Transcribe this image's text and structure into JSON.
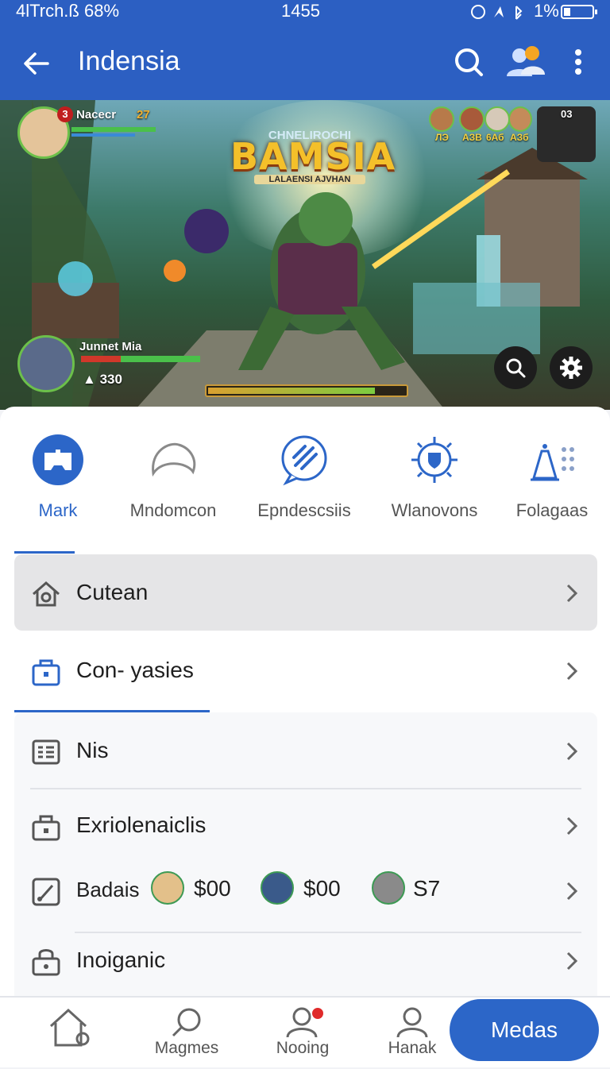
{
  "status_bar": {
    "left": "4lTrch.ß 68%",
    "time": "1455",
    "right": "1%"
  },
  "app_bar": {
    "title": "Indensia"
  },
  "hero": {
    "game_title": "BAMSIA",
    "game_supertitle": "CHNELIROCHI",
    "game_subtitle": "LALAENSI AJVHAN",
    "player1_name": "Nacecr",
    "player1_level": "27",
    "player1_badge": "3",
    "player2_name": "Junnet Mia",
    "player2_score": "330",
    "top_right_count": "03",
    "team_labels": [
      "ЛЭ",
      "АЗВ",
      "6Аб",
      "АЗб"
    ]
  },
  "categories": [
    {
      "label": "Mark",
      "icon": "gamepad-icon"
    },
    {
      "label": "Mndomcon",
      "icon": "arch-icon"
    },
    {
      "label": "Epndescsiis",
      "icon": "stripes-chat-icon"
    },
    {
      "label": "Wlanovons",
      "icon": "shield-sun-icon"
    },
    {
      "label": "Folagaas",
      "icon": "cone-dots-icon"
    }
  ],
  "menu": {
    "cutean": "Cutean",
    "con_yasies": "Con- yasies",
    "nis": "Nis",
    "exriolenaiclis": "Exriolenaiclis",
    "badais": "Badais",
    "badais_values": [
      "$00",
      "$00",
      "S7"
    ],
    "inoiganic": "Inoiganic"
  },
  "bottom_nav": {
    "home": "",
    "magmes": "Magmes",
    "nooing": "Nooing",
    "hanak": "Hanak",
    "medas": "Medas"
  },
  "colors": {
    "primary": "#2c5fc2",
    "accent": "#2c66c8",
    "notification": "#e02a2a"
  }
}
